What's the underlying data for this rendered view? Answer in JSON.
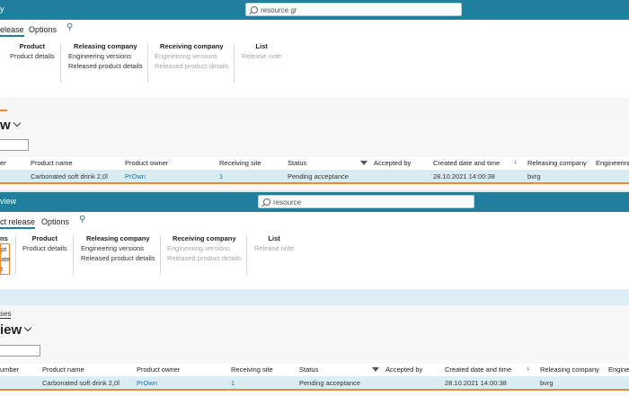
{
  "top": {
    "breadcrumb": "y",
    "search_value": "resource gr",
    "tabs": {
      "release": "elease",
      "options": "Options"
    },
    "groups": {
      "product": {
        "title": "Product",
        "items": [
          "Product details"
        ]
      },
      "releasing": {
        "title": "Releasing company",
        "items": [
          "Engineering versions",
          "Released product details"
        ]
      },
      "receiving": {
        "title": "Receiving company",
        "items": [
          "Engineering versions",
          "Released product details"
        ]
      },
      "list": {
        "title": "List",
        "items": [
          "Release note"
        ]
      }
    },
    "view_title": "w",
    "columns": [
      "er",
      "Product name",
      "Product owner",
      "Receiving site",
      "Status",
      "Accepted by",
      "Created date and time",
      "Releasing company",
      "Engineering"
    ],
    "row": [
      "Carbonated soft drink 2,0l",
      "PrOwn",
      "1",
      "Pending acceptance",
      "28.10.2021 14:00:38",
      "bvrg"
    ]
  },
  "bottom": {
    "breadcrumb": "view",
    "search_value": "resource",
    "tabs": {
      "release": "ct release",
      "options": "Options"
    },
    "left_group": {
      "title": "ns",
      "items": [
        "pt",
        "ate",
        "t"
      ]
    },
    "groups": {
      "product": {
        "title": "Product",
        "items": [
          "Product details"
        ]
      },
      "releasing": {
        "title": "Releasing company",
        "items": [
          "Engineering versions",
          "Released product details"
        ]
      },
      "receiving": {
        "title": "Receiving company",
        "items": [
          "Engineering versions",
          "Released product details"
        ]
      },
      "list": {
        "title": "List",
        "items": [
          "Release note"
        ]
      }
    },
    "breadcrumb_link": "ses",
    "view_title": "iew",
    "columns": [
      "umber",
      "Product name",
      "Product owner",
      "Receiving site",
      "Status",
      "Accepted by",
      "Created date and time",
      "Releasing company",
      "Engine"
    ],
    "row": [
      "Carbonated soft drink 2,0l",
      "PrOwn",
      "1",
      "Pending acceptance",
      "28.10.2021 14:00:38",
      "bvrg"
    ]
  },
  "colors": {
    "accent": "#1f7f9c",
    "highlight": "#f08a24",
    "row_selected": "#d8ecf1",
    "link": "#1a6fb5"
  }
}
